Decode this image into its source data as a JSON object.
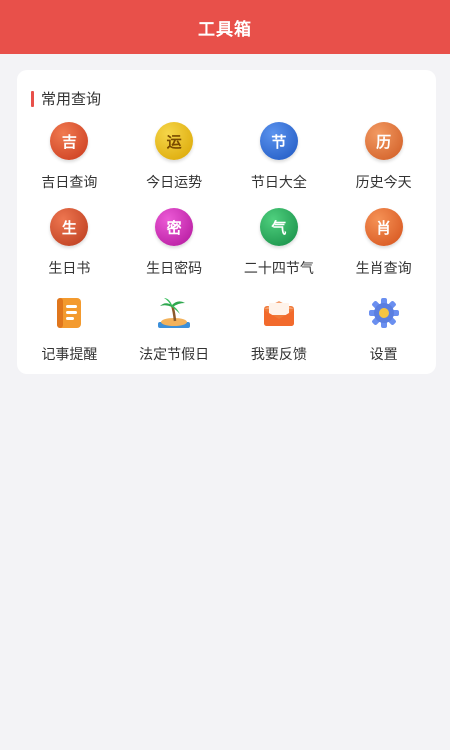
{
  "header": {
    "title": "工具箱"
  },
  "section": {
    "title": "常用查询"
  },
  "tools": [
    {
      "label": "吉日查询",
      "glyph": "吉",
      "color": "#e0542e",
      "icon": "auspicious-day-icon"
    },
    {
      "label": "今日运势",
      "glyph": "运",
      "color": "#e5b90e",
      "icon": "fortune-icon"
    },
    {
      "label": "节日大全",
      "glyph": "节",
      "color": "#2f6fd6",
      "icon": "festival-icon"
    },
    {
      "label": "历史今天",
      "glyph": "历",
      "color": "#e0743a",
      "icon": "history-icon"
    },
    {
      "label": "生日书",
      "glyph": "生",
      "color": "#d4502e",
      "icon": "birthday-book-icon"
    },
    {
      "label": "生日密码",
      "glyph": "密",
      "color": "#d322b4",
      "icon": "birthday-code-icon"
    },
    {
      "label": "二十四节气",
      "glyph": "气",
      "color": "#1fae5a",
      "icon": "solar-terms-icon"
    },
    {
      "label": "生肖查询",
      "glyph": "肖",
      "color": "#ea6a28",
      "icon": "zodiac-icon"
    },
    {
      "label": "记事提醒",
      "glyph": "",
      "color": "#f08a2a",
      "icon": "notepad-icon"
    },
    {
      "label": "法定节假日",
      "glyph": "",
      "color": "#3aa655",
      "icon": "beach-palm-icon"
    },
    {
      "label": "我要反馈",
      "glyph": "",
      "color": "#f07a3a",
      "icon": "mail-envelope-icon"
    },
    {
      "label": "设置",
      "glyph": "",
      "color": "#5b7fe0",
      "icon": "gear-icon"
    }
  ]
}
